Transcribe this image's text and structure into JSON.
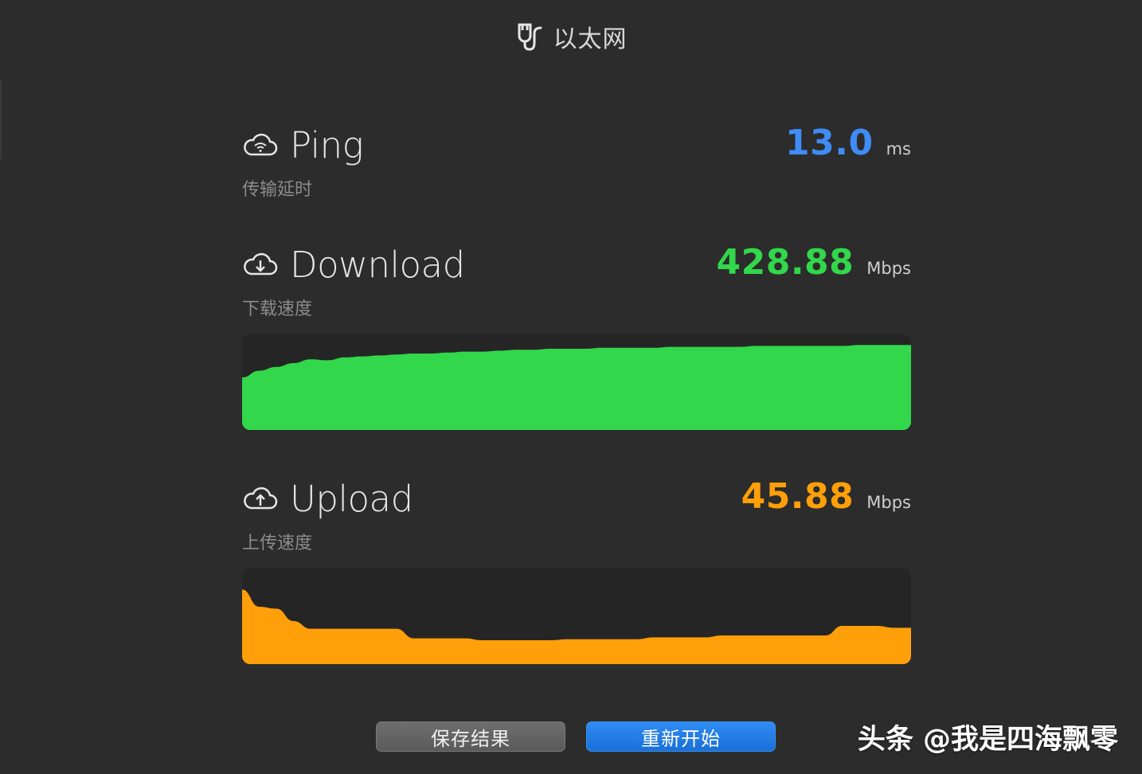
{
  "window": {
    "title": "以太网",
    "icon": "ethernet-plug-icon"
  },
  "ping": {
    "label": "Ping",
    "sublabel": "传输延时",
    "value": "13.0",
    "unit": "ms",
    "icon": "cloud-wifi-icon",
    "color": "#3f8cf5"
  },
  "download": {
    "label": "Download",
    "sublabel": "下载速度",
    "value": "428.88",
    "unit": "Mbps",
    "icon": "cloud-download-icon",
    "color": "#32d74b"
  },
  "upload": {
    "label": "Upload",
    "sublabel": "上传速度",
    "value": "45.88",
    "unit": "Mbps",
    "icon": "cloud-upload-icon",
    "color": "#ff9f0a"
  },
  "graphs": {
    "download_levels": [
      0.55,
      0.62,
      0.66,
      0.7,
      0.74,
      0.73,
      0.76,
      0.77,
      0.78,
      0.79,
      0.8,
      0.8,
      0.81,
      0.82,
      0.82,
      0.83,
      0.84,
      0.84,
      0.85,
      0.85,
      0.85,
      0.86,
      0.86,
      0.86,
      0.86,
      0.87,
      0.87,
      0.87,
      0.87,
      0.87,
      0.88,
      0.88,
      0.88,
      0.88,
      0.88,
      0.88,
      0.89,
      0.89,
      0.89,
      0.89
    ],
    "upload_levels": [
      0.78,
      0.6,
      0.58,
      0.45,
      0.37,
      0.37,
      0.37,
      0.37,
      0.37,
      0.37,
      0.27,
      0.27,
      0.27,
      0.27,
      0.25,
      0.25,
      0.25,
      0.25,
      0.25,
      0.26,
      0.26,
      0.26,
      0.26,
      0.26,
      0.28,
      0.28,
      0.28,
      0.28,
      0.3,
      0.3,
      0.3,
      0.3,
      0.3,
      0.3,
      0.3,
      0.4,
      0.4,
      0.4,
      0.38,
      0.38
    ]
  },
  "buttons": {
    "save": "保存结果",
    "restart": "重新开始"
  },
  "watermark": "头条 @我是四海飘零"
}
